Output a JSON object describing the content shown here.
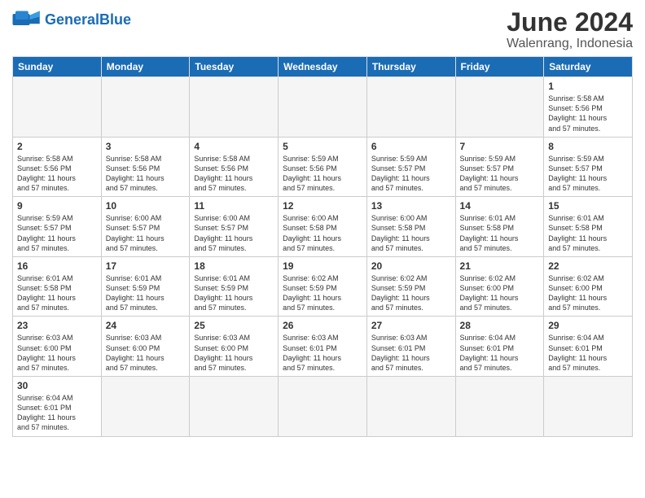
{
  "logo": {
    "text_general": "General",
    "text_blue": "Blue"
  },
  "title": "June 2024",
  "subtitle": "Walenrang, Indonesia",
  "days_of_week": [
    "Sunday",
    "Monday",
    "Tuesday",
    "Wednesday",
    "Thursday",
    "Friday",
    "Saturday"
  ],
  "weeks": [
    [
      {
        "day": "",
        "empty": true
      },
      {
        "day": "",
        "empty": true
      },
      {
        "day": "",
        "empty": true
      },
      {
        "day": "",
        "empty": true
      },
      {
        "day": "",
        "empty": true
      },
      {
        "day": "",
        "empty": true
      },
      {
        "day": "1",
        "sunrise": "5:58 AM",
        "sunset": "5:56 PM",
        "daylight": "11 hours and 57 minutes."
      }
    ],
    [
      {
        "day": "2",
        "sunrise": "5:58 AM",
        "sunset": "5:56 PM",
        "daylight": "11 hours and 57 minutes."
      },
      {
        "day": "3",
        "sunrise": "5:58 AM",
        "sunset": "5:56 PM",
        "daylight": "11 hours and 57 minutes."
      },
      {
        "day": "4",
        "sunrise": "5:58 AM",
        "sunset": "5:56 PM",
        "daylight": "11 hours and 57 minutes."
      },
      {
        "day": "5",
        "sunrise": "5:59 AM",
        "sunset": "5:56 PM",
        "daylight": "11 hours and 57 minutes."
      },
      {
        "day": "6",
        "sunrise": "5:59 AM",
        "sunset": "5:57 PM",
        "daylight": "11 hours and 57 minutes."
      },
      {
        "day": "7",
        "sunrise": "5:59 AM",
        "sunset": "5:57 PM",
        "daylight": "11 hours and 57 minutes."
      },
      {
        "day": "8",
        "sunrise": "5:59 AM",
        "sunset": "5:57 PM",
        "daylight": "11 hours and 57 minutes."
      }
    ],
    [
      {
        "day": "9",
        "sunrise": "5:59 AM",
        "sunset": "5:57 PM",
        "daylight": "11 hours and 57 minutes."
      },
      {
        "day": "10",
        "sunrise": "6:00 AM",
        "sunset": "5:57 PM",
        "daylight": "11 hours and 57 minutes."
      },
      {
        "day": "11",
        "sunrise": "6:00 AM",
        "sunset": "5:57 PM",
        "daylight": "11 hours and 57 minutes."
      },
      {
        "day": "12",
        "sunrise": "6:00 AM",
        "sunset": "5:58 PM",
        "daylight": "11 hours and 57 minutes."
      },
      {
        "day": "13",
        "sunrise": "6:00 AM",
        "sunset": "5:58 PM",
        "daylight": "11 hours and 57 minutes."
      },
      {
        "day": "14",
        "sunrise": "6:01 AM",
        "sunset": "5:58 PM",
        "daylight": "11 hours and 57 minutes."
      },
      {
        "day": "15",
        "sunrise": "6:01 AM",
        "sunset": "5:58 PM",
        "daylight": "11 hours and 57 minutes."
      }
    ],
    [
      {
        "day": "16",
        "sunrise": "6:01 AM",
        "sunset": "5:58 PM",
        "daylight": "11 hours and 57 minutes."
      },
      {
        "day": "17",
        "sunrise": "6:01 AM",
        "sunset": "5:59 PM",
        "daylight": "11 hours and 57 minutes."
      },
      {
        "day": "18",
        "sunrise": "6:01 AM",
        "sunset": "5:59 PM",
        "daylight": "11 hours and 57 minutes."
      },
      {
        "day": "19",
        "sunrise": "6:02 AM",
        "sunset": "5:59 PM",
        "daylight": "11 hours and 57 minutes."
      },
      {
        "day": "20",
        "sunrise": "6:02 AM",
        "sunset": "5:59 PM",
        "daylight": "11 hours and 57 minutes."
      },
      {
        "day": "21",
        "sunrise": "6:02 AM",
        "sunset": "6:00 PM",
        "daylight": "11 hours and 57 minutes."
      },
      {
        "day": "22",
        "sunrise": "6:02 AM",
        "sunset": "6:00 PM",
        "daylight": "11 hours and 57 minutes."
      }
    ],
    [
      {
        "day": "23",
        "sunrise": "6:03 AM",
        "sunset": "6:00 PM",
        "daylight": "11 hours and 57 minutes."
      },
      {
        "day": "24",
        "sunrise": "6:03 AM",
        "sunset": "6:00 PM",
        "daylight": "11 hours and 57 minutes."
      },
      {
        "day": "25",
        "sunrise": "6:03 AM",
        "sunset": "6:00 PM",
        "daylight": "11 hours and 57 minutes."
      },
      {
        "day": "26",
        "sunrise": "6:03 AM",
        "sunset": "6:01 PM",
        "daylight": "11 hours and 57 minutes."
      },
      {
        "day": "27",
        "sunrise": "6:03 AM",
        "sunset": "6:01 PM",
        "daylight": "11 hours and 57 minutes."
      },
      {
        "day": "28",
        "sunrise": "6:04 AM",
        "sunset": "6:01 PM",
        "daylight": "11 hours and 57 minutes."
      },
      {
        "day": "29",
        "sunrise": "6:04 AM",
        "sunset": "6:01 PM",
        "daylight": "11 hours and 57 minutes."
      }
    ],
    [
      {
        "day": "30",
        "sunrise": "6:04 AM",
        "sunset": "6:01 PM",
        "daylight": "11 hours and 57 minutes."
      },
      {
        "day": "",
        "empty": true
      },
      {
        "day": "",
        "empty": true
      },
      {
        "day": "",
        "empty": true
      },
      {
        "day": "",
        "empty": true
      },
      {
        "day": "",
        "empty": true
      },
      {
        "day": "",
        "empty": true
      }
    ]
  ],
  "labels": {
    "sunrise": "Sunrise:",
    "sunset": "Sunset:",
    "daylight": "Daylight:"
  }
}
